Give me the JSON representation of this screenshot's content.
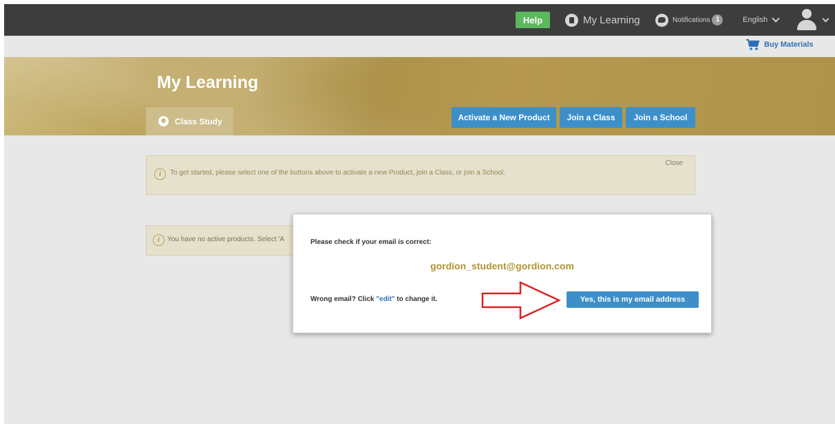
{
  "topnav": {
    "help_label": "Help",
    "my_learning_label": "My Learning",
    "notifications_label": "Notifications",
    "notifications_count": "1",
    "language_label": "English",
    "icons": {
      "my_learning": "book-icon",
      "notifications": "chat-bubble-icon",
      "language": "chevron-down-icon",
      "user": "user-avatar-icon"
    }
  },
  "subbar": {
    "buy_materials_label": "Buy Materials",
    "icon": "shopping-cart-icon"
  },
  "banner": {
    "title": "My Learning",
    "tab_label": "Class Study",
    "buttons": {
      "activate": "Activate a New Product",
      "join_class": "Join a Class",
      "join_school": "Join a School"
    }
  },
  "info_box": {
    "text": "To get started, please select one of the buttons above to activate a new Product, join a Class, or join a School.",
    "close_label": "Close"
  },
  "products_box": {
    "text": "You have no active products. Select 'A"
  },
  "modal": {
    "title": "Please check if your email is correct:",
    "email": "gordion_student@gordion.com",
    "wrong_prefix": "Wrong email? Click ",
    "edit_label": "\"edit\"",
    "wrong_suffix": " to change it.",
    "confirm_label": "Yes, this is my email address"
  },
  "colors": {
    "nav_bg": "#3d3d3d",
    "help_green": "#5cb85c",
    "banner_gold": "#b99e55",
    "button_blue": "#3d8fc9",
    "email_gold": "#b09434",
    "arrow_red": "#e02020"
  }
}
